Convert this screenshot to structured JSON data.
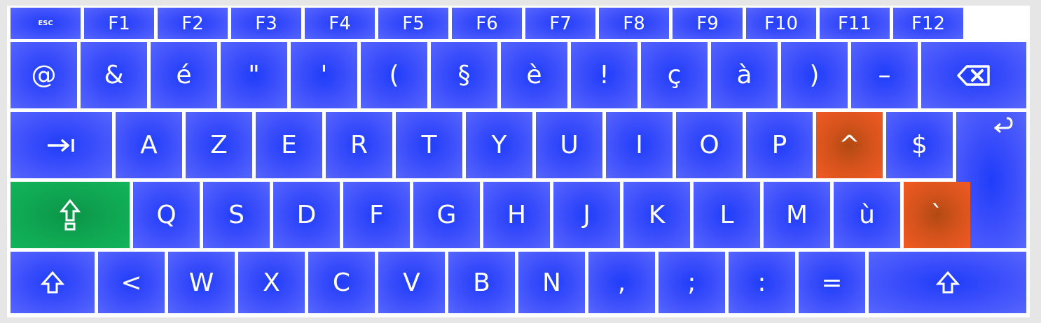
{
  "function_row": [
    "ESC",
    "F1",
    "F2",
    "F3",
    "F4",
    "F5",
    "F6",
    "F7",
    "F8",
    "F9",
    "F10",
    "F11",
    "F12"
  ],
  "number_row": [
    "@",
    "&",
    "é",
    "\"",
    "'",
    "(",
    "§",
    "è",
    "!",
    "ç",
    "à",
    ")",
    "–"
  ],
  "top_row": [
    "A",
    "Z",
    "E",
    "R",
    "T",
    "Y",
    "U",
    "I",
    "O",
    "P",
    "^",
    "$"
  ],
  "home_row": [
    "Q",
    "S",
    "D",
    "F",
    "G",
    "H",
    "J",
    "K",
    "L",
    "M",
    "ù",
    "`"
  ],
  "bottom_row": [
    "<",
    "W",
    "X",
    "C",
    "V",
    "B",
    "N",
    ",",
    ";",
    ":",
    "="
  ],
  "special_keys": {
    "backspace_icon": "backspace-icon",
    "tab_icon": "tab-icon",
    "enter_icon": "enter-icon",
    "caps_lock_icon": "caps-lock-icon",
    "shift_icon": "shift-icon"
  },
  "colors": {
    "key": "#3a4dfb",
    "highlight_dead_key": "#d4521c",
    "caps_lock_active": "#0fa652",
    "keyboard_bg": "#ffffff",
    "frame_bg": "#e6e6e6"
  },
  "highlighted_keys": [
    "^",
    "`"
  ],
  "active_modifier": "caps-lock"
}
